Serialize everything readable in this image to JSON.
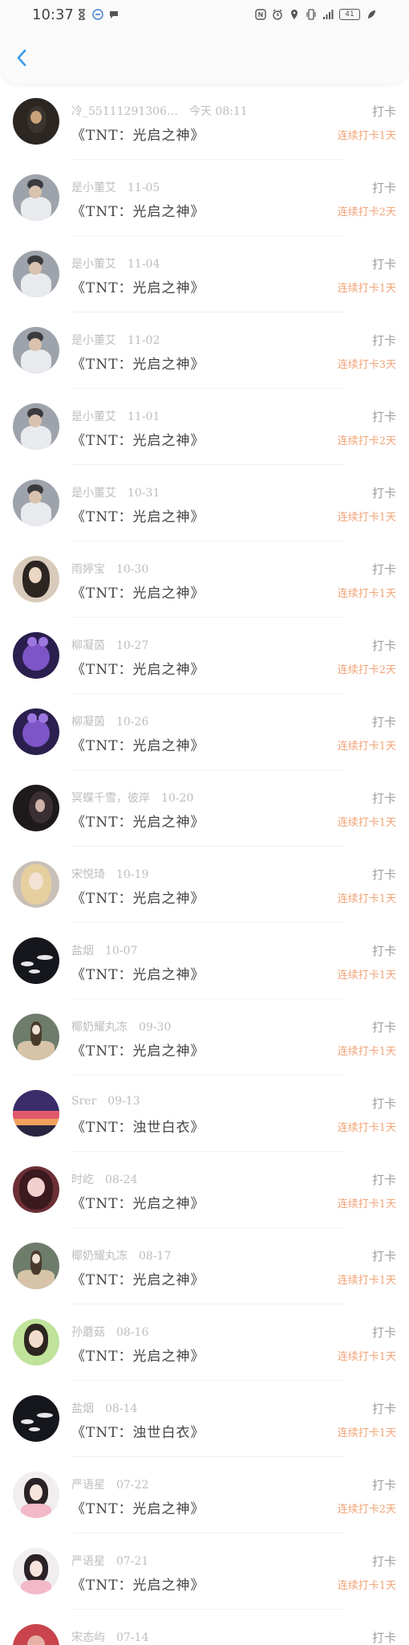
{
  "status_bar": {
    "time": "10:37",
    "left_icons": [
      "hourglass-icon",
      "minus-circle-icon",
      "chat-bubble-icon"
    ],
    "right_icons": [
      "nfc-icon",
      "alarm-icon",
      "location-icon",
      "vibrate-icon",
      "signal-4g-icon",
      "battery-icon",
      "leaf-icon"
    ],
    "battery": "41"
  },
  "header": {
    "back_icon": "chevron-left-icon",
    "accent": "#3a9be8"
  },
  "colors": {
    "streak": "#f0a377",
    "meta": "#bdbdbd"
  },
  "records": [
    {
      "user": "冷_55111291306…",
      "date": "今天 08:11",
      "book": "《TNT：光启之神》",
      "action": "打卡",
      "streak": "连续打卡1天",
      "avatar": "dark-portrait"
    },
    {
      "user": "是小董艾",
      "date": "11-05",
      "book": "《TNT：光启之神》",
      "action": "打卡",
      "streak": "连续打卡2天",
      "avatar": "boy-white-shirt"
    },
    {
      "user": "是小董艾",
      "date": "11-04",
      "book": "《TNT：光启之神》",
      "action": "打卡",
      "streak": "连续打卡1天",
      "avatar": "boy-white-shirt"
    },
    {
      "user": "是小董艾",
      "date": "11-02",
      "book": "《TNT：光启之神》",
      "action": "打卡",
      "streak": "连续打卡3天",
      "avatar": "boy-white-shirt"
    },
    {
      "user": "是小董艾",
      "date": "11-01",
      "book": "《TNT：光启之神》",
      "action": "打卡",
      "streak": "连续打卡2天",
      "avatar": "boy-white-shirt"
    },
    {
      "user": "是小董艾",
      "date": "10-31",
      "book": "《TNT：光启之神》",
      "action": "打卡",
      "streak": "连续打卡1天",
      "avatar": "boy-white-shirt"
    },
    {
      "user": "雨婷宝",
      "date": "10-30",
      "book": "《TNT：光启之神》",
      "action": "打卡",
      "streak": "连续打卡1天",
      "avatar": "girl-dark-hair"
    },
    {
      "user": "柳凝茵",
      "date": "10-27",
      "book": "《TNT：光启之神》",
      "action": "打卡",
      "streak": "连续打卡2天",
      "avatar": "purple-bear"
    },
    {
      "user": "柳凝茵",
      "date": "10-26",
      "book": "《TNT：光启之神》",
      "action": "打卡",
      "streak": "连续打卡1天",
      "avatar": "purple-bear"
    },
    {
      "user": "冥蝶千雪，彼岸",
      "date": "10-20",
      "book": "《TNT：光启之神》",
      "action": "打卡",
      "streak": "连续打卡1天",
      "avatar": "dark-girl-profile"
    },
    {
      "user": "宋悦琦",
      "date": "10-19",
      "book": "《TNT：光启之神》",
      "action": "打卡",
      "streak": "连续打卡1天",
      "avatar": "blonde-girl"
    },
    {
      "user": "盐烟",
      "date": "10-07",
      "book": "《TNT：光启之神》",
      "action": "打卡",
      "streak": "连续打卡1天",
      "avatar": "black-white-birds"
    },
    {
      "user": "椰奶耀丸冻",
      "date": "09-30",
      "book": "《TNT：光启之神》",
      "action": "打卡",
      "streak": "连续打卡1天",
      "avatar": "girl-outdoors"
    },
    {
      "user": "Srer",
      "date": "09-13",
      "book": "《TNT：浊世白衣》",
      "action": "打卡",
      "streak": "连续打卡1天",
      "avatar": "sunset-sky"
    },
    {
      "user": "时屹",
      "date": "08-24",
      "book": "《TNT：光启之神》",
      "action": "打卡",
      "streak": "连续打卡1天",
      "avatar": "pink-girl"
    },
    {
      "user": "椰奶耀丸冻",
      "date": "08-17",
      "book": "《TNT：光启之神》",
      "action": "打卡",
      "streak": "连续打卡1天",
      "avatar": "girl-outdoors"
    },
    {
      "user": "孙蘑菇",
      "date": "08-16",
      "book": "《TNT：光启之神》",
      "action": "打卡",
      "streak": "连续打卡1天",
      "avatar": "green-girl"
    },
    {
      "user": "盐烟",
      "date": "08-14",
      "book": "《TNT：浊世白衣》",
      "action": "打卡",
      "streak": "连续打卡1天",
      "avatar": "black-white-birds"
    },
    {
      "user": "严语星",
      "date": "07-22",
      "book": "《TNT：光启之神》",
      "action": "打卡",
      "streak": "连续打卡2天",
      "avatar": "white-girl"
    },
    {
      "user": "严语星",
      "date": "07-21",
      "book": "《TNT：光启之神》",
      "action": "打卡",
      "streak": "连续打卡1天",
      "avatar": "white-girl"
    },
    {
      "user": "宋态屿",
      "date": "07-14",
      "book": "",
      "action": "打卡",
      "streak": "",
      "avatar": "red-partial"
    }
  ]
}
